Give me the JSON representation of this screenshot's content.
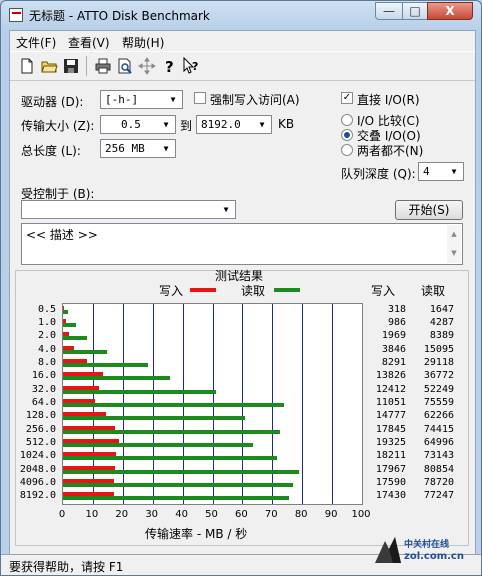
{
  "window": {
    "title": "无标题 - ATTO Disk Benchmark",
    "min": "—",
    "max": "□",
    "close": "X"
  },
  "menu": [
    "文件(F)",
    "查看(V)",
    "帮助(H)"
  ],
  "toolbar": {
    "icons": [
      "new-icon",
      "open-icon",
      "save-icon",
      "print-icon",
      "print-preview-icon",
      "move-icon",
      "help-icon",
      "context-help-icon"
    ]
  },
  "settings": {
    "drive_label": "驱动器 (D):",
    "drive_value": "[-h-]",
    "force_write_label": "强制写入访问(A)",
    "transfer_label": "传输大小 (Z):",
    "transfer_from": "0.5",
    "to_label": "到",
    "transfer_to": "8192.0",
    "kb_label": "KB",
    "total_label": "总长度 (L):",
    "total_value": "256 MB",
    "direct_io_label": "直接 I/O(R)",
    "io_compare_label": "I/O 比较(C)",
    "overlap_io_label": "交叠 I/O(O)",
    "neither_label": "两者都不(N)",
    "queue_label": "队列深度 (Q):",
    "queue_value": "4",
    "controlled_label": "受控制于 (B):",
    "controlled_value": "",
    "start_button": "开始(S)",
    "description": "<< 描述 >>"
  },
  "results": {
    "title": "测试结果",
    "legend_write": "写入",
    "legend_read": "读取",
    "col_write": "写入",
    "col_read": "读取",
    "xlabel": "传输速率 - MB / 秒"
  },
  "chart_data": {
    "type": "bar",
    "title": "测试结果",
    "xlabel": "传输速率 - MB / 秒",
    "xlim": [
      0,
      100
    ],
    "x_ticks": [
      "0",
      "10",
      "20",
      "30",
      "40",
      "50",
      "60",
      "70",
      "80",
      "90",
      "100"
    ],
    "categories": [
      "0.5",
      "1.0",
      "2.0",
      "4.0",
      "8.0",
      "16.0",
      "32.0",
      "64.0",
      "128.0",
      "256.0",
      "512.0",
      "1024.0",
      "2048.0",
      "4096.0",
      "8192.0"
    ],
    "series": [
      {
        "name": "写入",
        "color": "#e41616",
        "values": [
          318,
          986,
          1969,
          3846,
          8291,
          13826,
          12412,
          11051,
          14777,
          17845,
          19325,
          18211,
          17967,
          17590,
          17430
        ]
      },
      {
        "name": "读取",
        "color": "#1c8a1c",
        "values": [
          1647,
          4287,
          8389,
          15095,
          29118,
          36772,
          52249,
          75559,
          62266,
          74415,
          64996,
          73143,
          80854,
          78720,
          77247
        ]
      }
    ],
    "grid": true,
    "legend": "top"
  },
  "status": {
    "text": "要获得帮助，请按 F1"
  },
  "watermark": {
    "brand": "中关村在线",
    "url": "zol.com.cn"
  }
}
